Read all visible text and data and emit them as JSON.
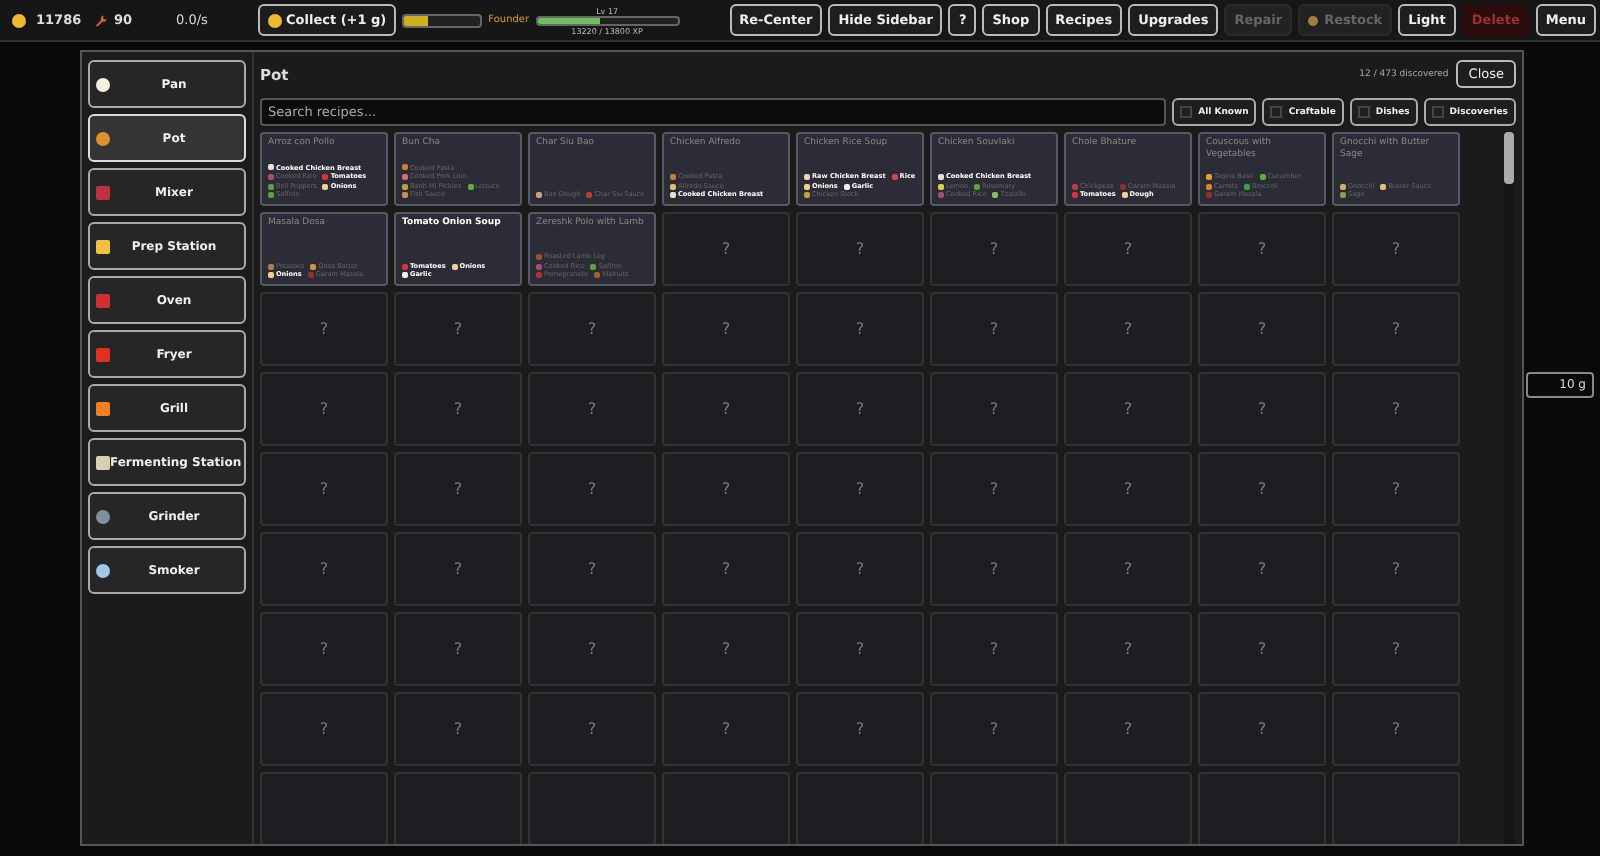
{
  "topbar": {
    "coins": "11786",
    "tools": "90",
    "rate": "0.0/s",
    "collect": "Collect (+1 g)",
    "gold_bar": {
      "level": 0.3
    },
    "rank": "Founder",
    "xp": {
      "label": "Lv 17",
      "level": 0.45,
      "reading": "13220 / 13800 XP"
    },
    "buttons": [
      {
        "label": "Re-Center",
        "kind": "normal"
      },
      {
        "label": "Hide Sidebar",
        "kind": "normal"
      },
      {
        "label": "?",
        "kind": "normal"
      },
      {
        "label": "Shop",
        "kind": "normal"
      },
      {
        "label": "Recipes",
        "kind": "normal"
      },
      {
        "label": "Upgrades",
        "kind": "normal"
      },
      {
        "label": "Repair",
        "kind": "disabled"
      },
      {
        "label": "Restock",
        "kind": "dot"
      },
      {
        "label": "Light",
        "kind": "normal"
      },
      {
        "label": "Delete",
        "kind": "danger"
      },
      {
        "label": "Menu",
        "kind": "normal"
      }
    ]
  },
  "sidebar": {
    "items": [
      {
        "label": "Pan",
        "kind": "egg",
        "selected": false
      },
      {
        "label": "Pot",
        "kind": "pot",
        "selected": true
      },
      {
        "label": "Mixer",
        "kind": "bowl",
        "selected": false
      },
      {
        "label": "Prep Station",
        "kind": "board",
        "selected": false
      },
      {
        "label": "Oven",
        "kind": "heat",
        "selected": false
      },
      {
        "label": "Fryer",
        "kind": "fries",
        "selected": false
      },
      {
        "label": "Grill",
        "kind": "flame",
        "selected": false
      },
      {
        "label": "Fermenting Station",
        "kind": "jar",
        "selected": false
      },
      {
        "label": "Grinder",
        "kind": "gear",
        "selected": false
      },
      {
        "label": "Smoker",
        "kind": "cloud",
        "selected": false
      }
    ]
  },
  "panel": {
    "title": "Pot",
    "discovered": "12 / 473 discovered",
    "close": "Close",
    "search": {
      "placeholder": "Search recipes..."
    },
    "filters": [
      "All Known",
      "Craftable",
      "Dishes",
      "Discoveries"
    ]
  },
  "right_panel": {
    "field": "10 g"
  },
  "cards": [
    {
      "kind": "recipe",
      "title": "Arroz con Pollo",
      "craftable": false,
      "ingredients": [
        {
          "name": "Cooked Chicken Breast",
          "known": true,
          "color": "#e8e0d0"
        },
        {
          "name": "Cooked Rice",
          "known": false,
          "color": "#a05070"
        },
        {
          "name": "Tomatoes",
          "known": true,
          "color": "#e03040"
        },
        {
          "name": "Bell Peppers",
          "known": false,
          "color": "#60a040"
        },
        {
          "name": "Onions",
          "known": true,
          "color": "#f0d090"
        },
        {
          "name": "Saffron",
          "known": false,
          "color": "#60a040"
        }
      ]
    },
    {
      "kind": "recipe",
      "title": "Bun Cha",
      "craftable": false,
      "ingredients": [
        {
          "name": "Cooked Pasta",
          "known": false,
          "color": "#c08040"
        },
        {
          "name": "Cooked Pork Loin",
          "known": false,
          "color": "#d07080"
        },
        {
          "name": "Banh Mi Pickles",
          "known": false,
          "color": "#c0a040"
        },
        {
          "name": "Lettuce",
          "known": false,
          "color": "#60b040"
        },
        {
          "name": "Fish Sauce",
          "known": false,
          "color": "#c09060"
        }
      ]
    },
    {
      "kind": "recipe",
      "title": "Char Siu Bao",
      "craftable": false,
      "ingredients": [
        {
          "name": "Bao Dough",
          "known": false,
          "color": "#d0a080"
        },
        {
          "name": "Char Siu Sauce",
          "known": false,
          "color": "#b04030"
        }
      ]
    },
    {
      "kind": "recipe",
      "title": "Chicken Alfredo",
      "craftable": false,
      "ingredients": [
        {
          "name": "Cooked Pasta",
          "known": false,
          "color": "#c08040"
        },
        {
          "name": "Alfredo Sauce",
          "known": false,
          "color": "#e0c070"
        },
        {
          "name": "Cooked Chicken Breast",
          "known": true,
          "color": "#e8e0d0"
        }
      ]
    },
    {
      "kind": "recipe",
      "title": "Chicken Rice Soup",
      "craftable": false,
      "ingredients": [
        {
          "name": "Raw Chicken Breast",
          "known": true,
          "color": "#f0d0c0"
        },
        {
          "name": "Rice",
          "known": true,
          "color": "#e04050"
        },
        {
          "name": "Onions",
          "known": true,
          "color": "#f0d090"
        },
        {
          "name": "Garlic",
          "known": true,
          "color": "#f0f0f0"
        },
        {
          "name": "Chicken Stock",
          "known": false,
          "color": "#c0a040"
        }
      ]
    },
    {
      "kind": "recipe",
      "title": "Chicken Souvlaki",
      "craftable": false,
      "ingredients": [
        {
          "name": "Cooked Chicken Breast",
          "known": true,
          "color": "#e8e0d0"
        },
        {
          "name": "Lemon",
          "known": false,
          "color": "#e0d040"
        },
        {
          "name": "Rosemary",
          "known": false,
          "color": "#60a040"
        },
        {
          "name": "Cooked Rice",
          "known": false,
          "color": "#a05070"
        },
        {
          "name": "Tzatziki",
          "known": false,
          "color": "#80c060"
        }
      ]
    },
    {
      "kind": "recipe",
      "title": "Chole Bhature",
      "craftable": false,
      "ingredients": [
        {
          "name": "Chickpeas",
          "known": false,
          "color": "#b04040"
        },
        {
          "name": "Garam Masala",
          "known": false,
          "color": "#903030"
        },
        {
          "name": "Tomatoes",
          "known": true,
          "color": "#e03040"
        },
        {
          "name": "Dough",
          "known": true,
          "color": "#f0d090"
        }
      ]
    },
    {
      "kind": "recipe",
      "title": "Couscous with Vegetables",
      "craftable": false,
      "ingredients": [
        {
          "name": "Tagine Base",
          "known": false,
          "color": "#e0a030"
        },
        {
          "name": "Cucumber",
          "known": false,
          "color": "#60b040"
        },
        {
          "name": "Carrots",
          "known": false,
          "color": "#e08030"
        },
        {
          "name": "Broccoli",
          "known": false,
          "color": "#40a040"
        },
        {
          "name": "Garam Masala",
          "known": false,
          "color": "#903030"
        }
      ]
    },
    {
      "kind": "recipe",
      "title": "Gnocchi with Butter Sage",
      "craftable": false,
      "ingredients": [
        {
          "name": "Gnocchi",
          "known": false,
          "color": "#d0b060"
        },
        {
          "name": "Butter Sauce",
          "known": false,
          "color": "#e0c070"
        },
        {
          "name": "Sage",
          "known": false,
          "color": "#80a060"
        }
      ]
    },
    {
      "kind": "recipe",
      "title": "Masala Dosa",
      "craftable": false,
      "ingredients": [
        {
          "name": "Potatoes",
          "known": false,
          "color": "#b08050"
        },
        {
          "name": "Dosa Batter",
          "known": false,
          "color": "#d09040"
        },
        {
          "name": "Onions",
          "known": true,
          "color": "#f0d090"
        },
        {
          "name": "Garam Masala",
          "known": false,
          "color": "#903030"
        }
      ]
    },
    {
      "kind": "recipe",
      "title": "Tomato Onion Soup",
      "craftable": true,
      "ingredients": [
        {
          "name": "Tomatoes",
          "known": true,
          "color": "#e03040"
        },
        {
          "name": "Onions",
          "known": true,
          "color": "#f0d090"
        },
        {
          "name": "Garlic",
          "known": true,
          "color": "#f0f0f0"
        }
      ]
    },
    {
      "kind": "recipe",
      "title": "Zereshk Polo with Lamb",
      "craftable": false,
      "ingredients": [
        {
          "name": "Roasted Lamb Leg",
          "known": false,
          "color": "#a05030"
        },
        {
          "name": "Cooked Rice",
          "known": false,
          "color": "#a05070"
        },
        {
          "name": "Saffron",
          "known": false,
          "color": "#60a040"
        },
        {
          "name": "Pomegranate",
          "known": false,
          "color": "#b03040"
        },
        {
          "name": "Walnuts",
          "known": false,
          "color": "#a06030"
        }
      ]
    },
    {
      "kind": "locked",
      "label": "?"
    },
    {
      "kind": "locked",
      "label": "?"
    },
    {
      "kind": "locked",
      "label": "?"
    },
    {
      "kind": "locked",
      "label": "?"
    },
    {
      "kind": "locked",
      "label": "?"
    },
    {
      "kind": "locked",
      "label": "?"
    },
    {
      "kind": "locked",
      "label": "?"
    },
    {
      "kind": "locked",
      "label": "?"
    },
    {
      "kind": "locked",
      "label": "?"
    },
    {
      "kind": "locked",
      "label": "?"
    },
    {
      "kind": "locked",
      "label": "?"
    },
    {
      "kind": "locked",
      "label": "?"
    },
    {
      "kind": "locked",
      "label": "?"
    },
    {
      "kind": "locked",
      "label": "?"
    },
    {
      "kind": "locked",
      "label": "?"
    },
    {
      "kind": "locked",
      "label": "?"
    },
    {
      "kind": "locked",
      "label": "?"
    },
    {
      "kind": "locked",
      "label": "?"
    },
    {
      "kind": "locked",
      "label": "?"
    },
    {
      "kind": "locked",
      "label": "?"
    },
    {
      "kind": "locked",
      "label": "?"
    },
    {
      "kind": "locked",
      "label": "?"
    },
    {
      "kind": "locked",
      "label": "?"
    },
    {
      "kind": "locked",
      "label": "?"
    },
    {
      "kind": "locked",
      "label": "?"
    },
    {
      "kind": "locked",
      "label": "?"
    },
    {
      "kind": "locked",
      "label": "?"
    },
    {
      "kind": "locked",
      "label": "?"
    },
    {
      "kind": "locked",
      "label": "?"
    },
    {
      "kind": "locked",
      "label": "?"
    },
    {
      "kind": "locked",
      "label": "?"
    },
    {
      "kind": "locked",
      "label": "?"
    },
    {
      "kind": "locked",
      "label": "?"
    },
    {
      "kind": "locked",
      "label": "?"
    },
    {
      "kind": "locked",
      "label": "?"
    },
    {
      "kind": "locked",
      "label": "?"
    },
    {
      "kind": "locked",
      "label": "?"
    },
    {
      "kind": "locked",
      "label": "?"
    },
    {
      "kind": "locked",
      "label": "?"
    },
    {
      "kind": "locked",
      "label": "?"
    },
    {
      "kind": "locked",
      "label": "?"
    },
    {
      "kind": "locked",
      "label": "?"
    },
    {
      "kind": "locked",
      "label": "?"
    },
    {
      "kind": "locked",
      "label": "?"
    },
    {
      "kind": "locked",
      "label": "?"
    },
    {
      "kind": "locked",
      "label": "?"
    },
    {
      "kind": "locked",
      "label": "?"
    },
    {
      "kind": "locked",
      "label": "?"
    },
    {
      "kind": "locked",
      "label": "?"
    },
    {
      "kind": "locked",
      "label": "?"
    },
    {
      "kind": "locked",
      "label": "?"
    },
    {
      "kind": "locked",
      "label": "?"
    },
    {
      "kind": "locked",
      "label": "?"
    },
    {
      "kind": "locked",
      "label": "?"
    },
    {
      "kind": "locked",
      "label": "?"
    },
    {
      "kind": "locked",
      "label": "?"
    },
    {
      "kind": "locked",
      "label": "?"
    },
    {
      "kind": "locked",
      "label": "?"
    },
    {
      "kind": "locked",
      "label": "?"
    },
    {
      "kind": "locked",
      "label": "?"
    },
    {
      "kind": "partial"
    },
    {
      "kind": "partial"
    },
    {
      "kind": "partial"
    },
    {
      "kind": "partial"
    },
    {
      "kind": "partial"
    },
    {
      "kind": "partial"
    },
    {
      "kind": "partial"
    },
    {
      "kind": "partial"
    },
    {
      "kind": "partial"
    }
  ]
}
